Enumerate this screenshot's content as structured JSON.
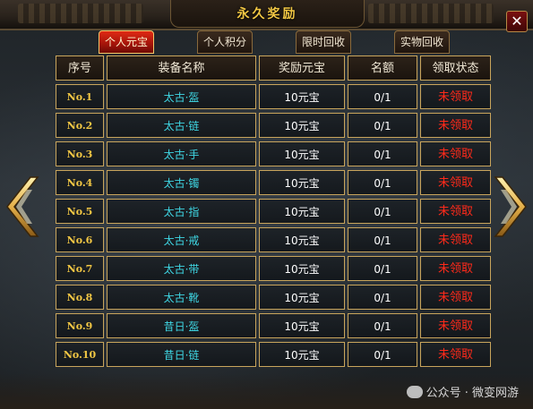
{
  "window": {
    "title": "永久奖励",
    "close_label": "✕"
  },
  "tabs": [
    {
      "label": "个人元宝",
      "active": true
    },
    {
      "label": "个人积分",
      "active": false
    },
    {
      "label": "限时回收",
      "active": false
    },
    {
      "label": "实物回收",
      "active": false
    }
  ],
  "table": {
    "headers": [
      "序号",
      "装备名称",
      "奖励元宝",
      "名额",
      "领取状态"
    ],
    "rows": [
      {
        "no": "No.1",
        "item": "太古·盔",
        "reward": "10元宝",
        "quota": "0/1",
        "status": "未领取"
      },
      {
        "no": "No.2",
        "item": "太古·链",
        "reward": "10元宝",
        "quota": "0/1",
        "status": "未领取"
      },
      {
        "no": "No.3",
        "item": "太古·手",
        "reward": "10元宝",
        "quota": "0/1",
        "status": "未领取"
      },
      {
        "no": "No.4",
        "item": "太古·镯",
        "reward": "10元宝",
        "quota": "0/1",
        "status": "未领取"
      },
      {
        "no": "No.5",
        "item": "太古·指",
        "reward": "10元宝",
        "quota": "0/1",
        "status": "未领取"
      },
      {
        "no": "No.6",
        "item": "太古·戒",
        "reward": "10元宝",
        "quota": "0/1",
        "status": "未领取"
      },
      {
        "no": "No.7",
        "item": "太古·带",
        "reward": "10元宝",
        "quota": "0/1",
        "status": "未领取"
      },
      {
        "no": "No.8",
        "item": "太古·靴",
        "reward": "10元宝",
        "quota": "0/1",
        "status": "未领取"
      },
      {
        "no": "No.9",
        "item": "昔日·盔",
        "reward": "10元宝",
        "quota": "0/1",
        "status": "未领取"
      },
      {
        "no": "No.10",
        "item": "昔日·链",
        "reward": "10元宝",
        "quota": "0/1",
        "status": "未领取"
      }
    ]
  },
  "nav": {
    "prev_icon": "chevron-left-icon",
    "next_icon": "chevron-right-icon"
  },
  "watermark": {
    "text": "公众号 · 微变网游"
  },
  "colors": {
    "title": "#f2c744",
    "item_name": "#3fd7e4",
    "status": "#ff2a1a",
    "row_number": "#f2c744",
    "border": "#c9a55c",
    "active_tab": "#d0200f"
  }
}
